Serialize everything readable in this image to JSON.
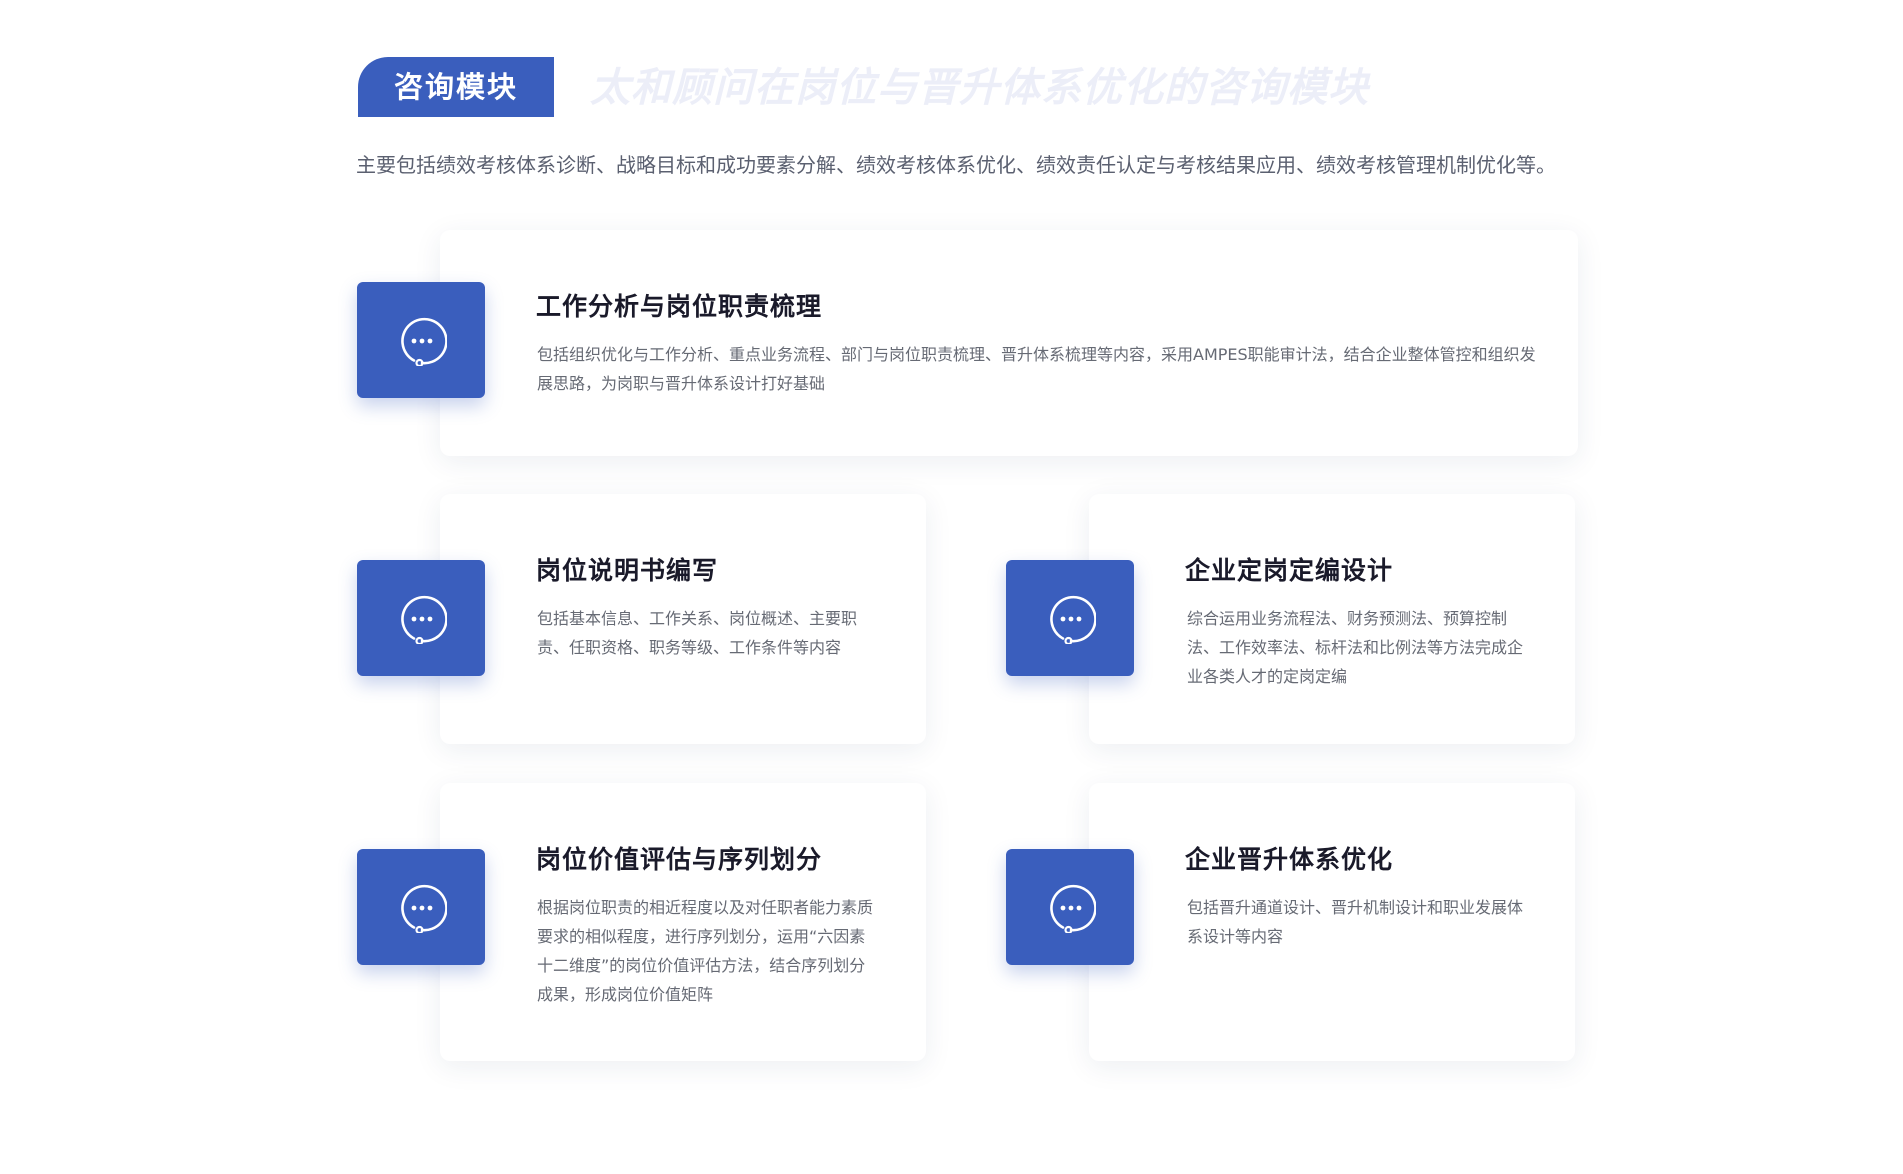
{
  "header": {
    "tag_label": "咨询模块",
    "ghost_title": "太和顾问在岗位与晋升体系优化的咨询模块",
    "intro": "主要包括绩效考核体系诊断、战略目标和成功要素分解、绩效考核体系优化、绩效责任认定与考核结果应用、绩效考核管理机制优化等。"
  },
  "cards": [
    {
      "title": "工作分析与岗位职责梳理",
      "description": "包括组织优化与工作分析、重点业务流程、部门与岗位职责梳理、晋升体系梳理等内容，采用AMPES职能审计法，结合企业整体管控和组织发展思路，为岗职与晋升体系设计打好基础",
      "icon": "chat-bubble-icon"
    },
    {
      "title": "岗位说明书编写",
      "description": "包括基本信息、工作关系、岗位概述、主要职责、任职资格、职务等级、工作条件等内容",
      "icon": "chat-bubble-icon"
    },
    {
      "title": "企业定岗定编设计",
      "description": "综合运用业务流程法、财务预测法、预算控制法、工作效率法、标杆法和比例法等方法完成企业各类人才的定岗定编",
      "icon": "chat-bubble-icon"
    },
    {
      "title": "岗位价值评估与序列划分",
      "description": "根据岗位职责的相近程度以及对任职者能力素质要求的相似程度，进行序列划分，运用“六因素十二维度”的岗位价值评估方法，结合序列划分成果，形成岗位价值矩阵",
      "icon": "chat-bubble-icon"
    },
    {
      "title": "企业晋升体系优化",
      "description": "包括晋升通道设计、晋升机制设计和职业发展体系设计等内容",
      "icon": "chat-bubble-icon"
    }
  ],
  "colors": {
    "accent": "#3a5ebd",
    "ghost_text": "#eceef8",
    "title_text": "#1a1a2a",
    "body_text": "#666a74"
  }
}
